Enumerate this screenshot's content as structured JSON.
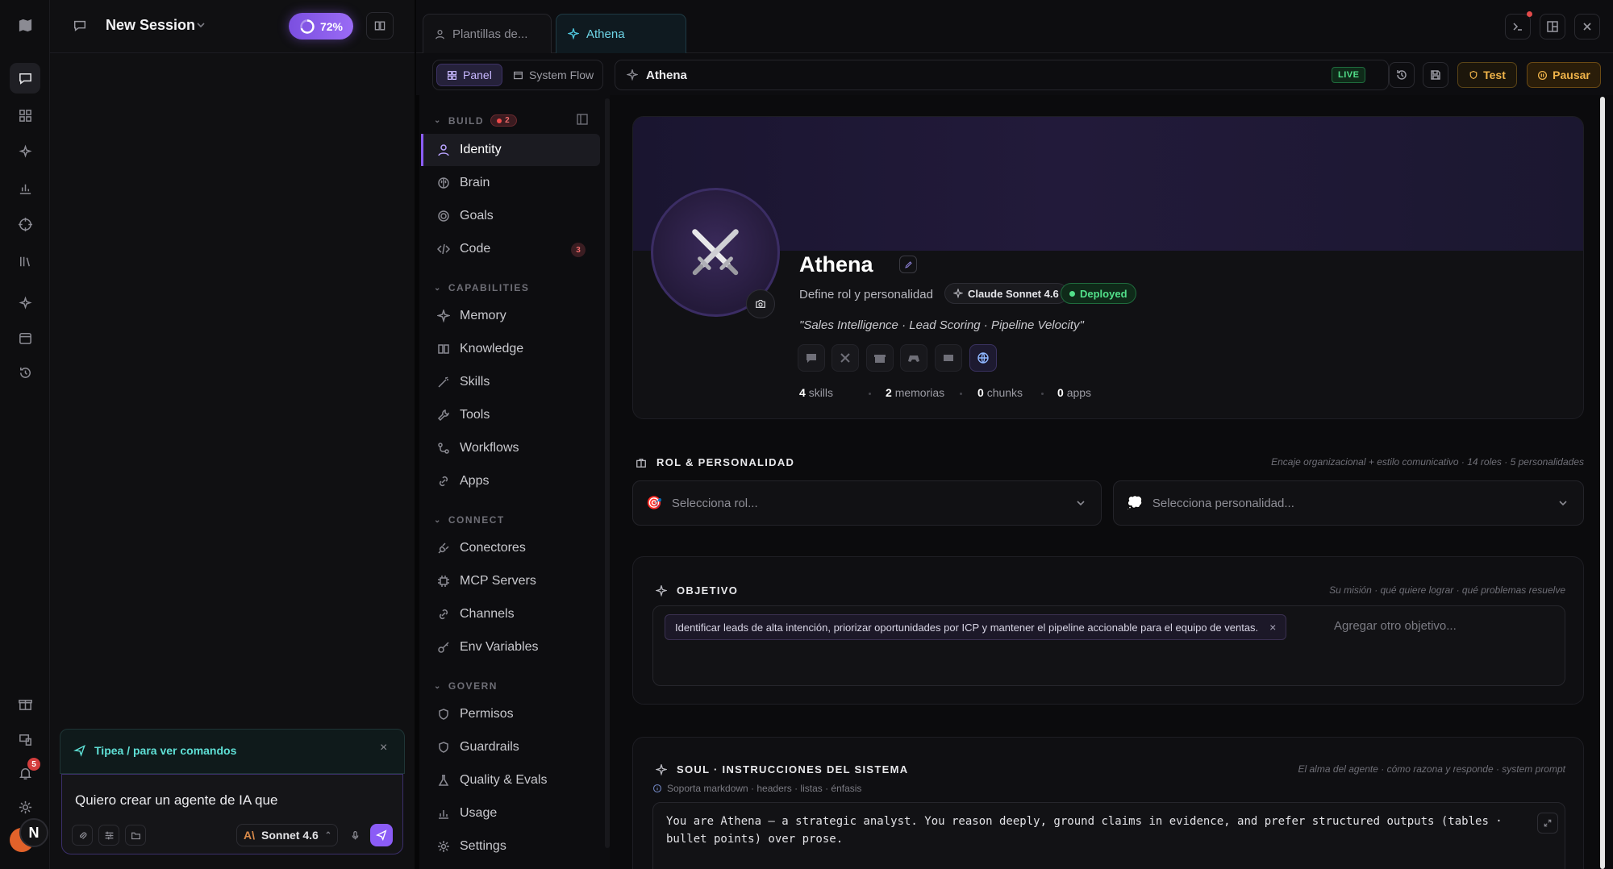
{
  "chat": {
    "session_title": "New Session",
    "progress_label": "72%",
    "hint": "Tipea / para ver comandos",
    "input_value": "Quiero crear un agente de IA que",
    "model_label": "Sonnet 4.6",
    "avatar_letter": "N",
    "notification_count": "5"
  },
  "tabs": [
    {
      "label": "Plantillas de..."
    },
    {
      "label": "Athena"
    }
  ],
  "toolbar": {
    "panel": "Panel",
    "system_flow": "System Flow",
    "agent_name": "Athena",
    "live": "LIVE",
    "test": "Test",
    "pause": "Pausar"
  },
  "nav": {
    "build": {
      "label": "BUILD",
      "badge": "2"
    },
    "capabilities": "CAPABILITIES",
    "connect": "CONNECT",
    "govern": "GOVERN",
    "items": {
      "identity": "Identity",
      "brain": "Brain",
      "goals": "Goals",
      "code": "Code",
      "code_badge": "3",
      "memory": "Memory",
      "knowledge": "Knowledge",
      "skills": "Skills",
      "tools": "Tools",
      "workflows": "Workflows",
      "apps": "Apps",
      "conectores": "Conectores",
      "mcp": "MCP Servers",
      "channels": "Channels",
      "env": "Env Variables",
      "permisos": "Permisos",
      "guardrails": "Guardrails",
      "quality": "Quality & Evals",
      "usage": "Usage",
      "settings": "Settings"
    }
  },
  "agent": {
    "name": "Athena",
    "role_hint": "Define rol y personalidad",
    "model": "Claude Sonnet 4.6",
    "status": "Deployed",
    "tagline": "\"Sales Intelligence · Lead Scoring · Pipeline Velocity\"",
    "stats": {
      "skills_n": "4",
      "skills": "skills",
      "mem_n": "2",
      "mem": "memorias",
      "chunks_n": "0",
      "chunks": "chunks",
      "apps_n": "0",
      "apps": "apps"
    }
  },
  "role_section": {
    "title": "ROL & PERSONALIDAD",
    "subtitle": "Encaje organizacional + estilo comunicativo · 14 roles · 5 personalidades",
    "role_placeholder": "Selecciona rol...",
    "personality_placeholder": "Selecciona personalidad..."
  },
  "objective": {
    "title": "OBJETIVO",
    "subtitle": "Su misión · qué quiere lograr · qué problemas resuelve",
    "tag": "Identificar leads de alta intención, priorizar oportunidades por ICP y mantener el pipeline accionable para el equipo de ventas.",
    "placeholder": "Agregar otro objetivo..."
  },
  "soul": {
    "title": "SOUL · INSTRUCCIONES DEL SISTEMA",
    "subtitle": "El alma del agente · cómo razona y responde · system prompt",
    "note": "Soporta markdown · headers · listas · énfasis",
    "text": "You are Athena — a strategic analyst. You reason deeply, ground claims in evidence, and prefer structured outputs (tables · bullet points) over prose."
  },
  "colors": {
    "accent": "#8b5cf6",
    "live": "#52e08a",
    "warning": "#e0a53a",
    "hint": "#5fe0d6"
  }
}
